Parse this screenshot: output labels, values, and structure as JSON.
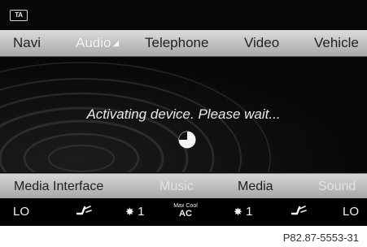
{
  "status_bar": {
    "badge": "TA"
  },
  "main_menu": [
    {
      "label": "Navi"
    },
    {
      "label": "Audio",
      "selected": true
    },
    {
      "label": "Telephone"
    },
    {
      "label": "Video"
    },
    {
      "label": "Vehicle"
    }
  ],
  "content": {
    "message": "Activating device. Please wait...",
    "progress": 0.25
  },
  "sub_menu": [
    {
      "label": "Media Interface",
      "enabled": true
    },
    {
      "label": "Music",
      "enabled": false
    },
    {
      "label": "Media",
      "enabled": true
    },
    {
      "label": "Sound",
      "enabled": false
    }
  ],
  "climate": {
    "left_temp": "LO",
    "left_fan": "1",
    "max_cool_top": "Max Cool",
    "max_cool_bottom": "AC",
    "right_fan": "1",
    "right_temp": "LO"
  },
  "reference": "P82.87-5553-31",
  "colors": {
    "menu_bar": "#c4c4c4",
    "screen_bg": "#000000",
    "selected_text": "#f6f6f6"
  }
}
